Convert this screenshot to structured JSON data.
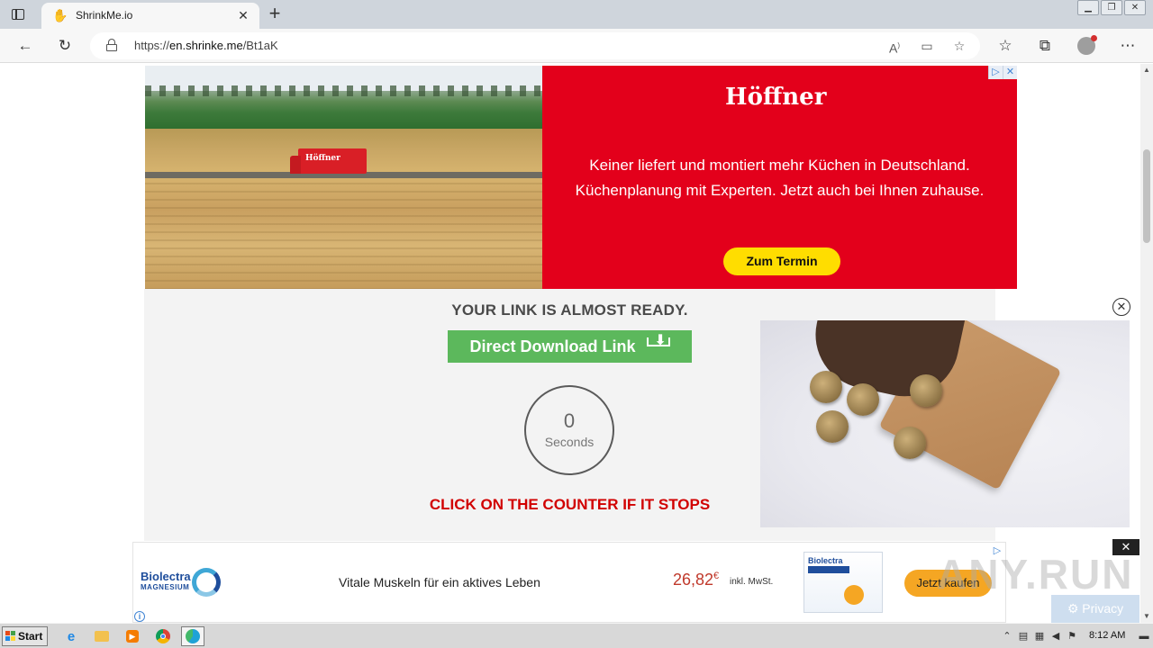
{
  "browser": {
    "tab_title": "ShrinkMe.io",
    "url_prefix": "https://",
    "url_domain": "en.shrinke.me",
    "url_path": "/Bt1aK"
  },
  "ads": {
    "top": {
      "truck_label": "Höffner",
      "logo": "Höffner",
      "line1": "Keiner liefert und montiert mehr Küchen in Deutschland.",
      "line2": "Küchenplanung mit Experten. Jetzt auch bei Ihnen zuhause.",
      "cta": "Zum Termin"
    },
    "bottom": {
      "brand_name": "Biolectra",
      "brand_sub": "MAGNESIUM",
      "slogan": "Vitale Muskeln für ein aktives Leben",
      "price": "26,82",
      "currency": "€",
      "tax_note": "inkl. MwSt.",
      "pack_title": "Biolectra",
      "cta": "Jetzt kaufen"
    }
  },
  "main": {
    "heading": "YOUR LINK IS ALMOST READY.",
    "download_label": "Direct Download Link",
    "counter_value": "0",
    "counter_unit": "Seconds",
    "hint": "CLICK ON THE COUNTER IF IT STOPS"
  },
  "overlay": {
    "watermark": "ANY.RUN",
    "privacy": "Privacy"
  },
  "taskbar": {
    "start_label": "Start",
    "clock": "8:12 AM"
  },
  "colors": {
    "download_green": "#5cb85c",
    "hint_red": "#d10000",
    "ad_red": "#e3001b",
    "ad_yellow": "#ffdd00",
    "buy_orange": "#f5a623"
  },
  "icons": {
    "tab_favicon": "shrinkme-hand-icon",
    "video_close": "circle-x-icon",
    "ad_close": "x-icon"
  }
}
